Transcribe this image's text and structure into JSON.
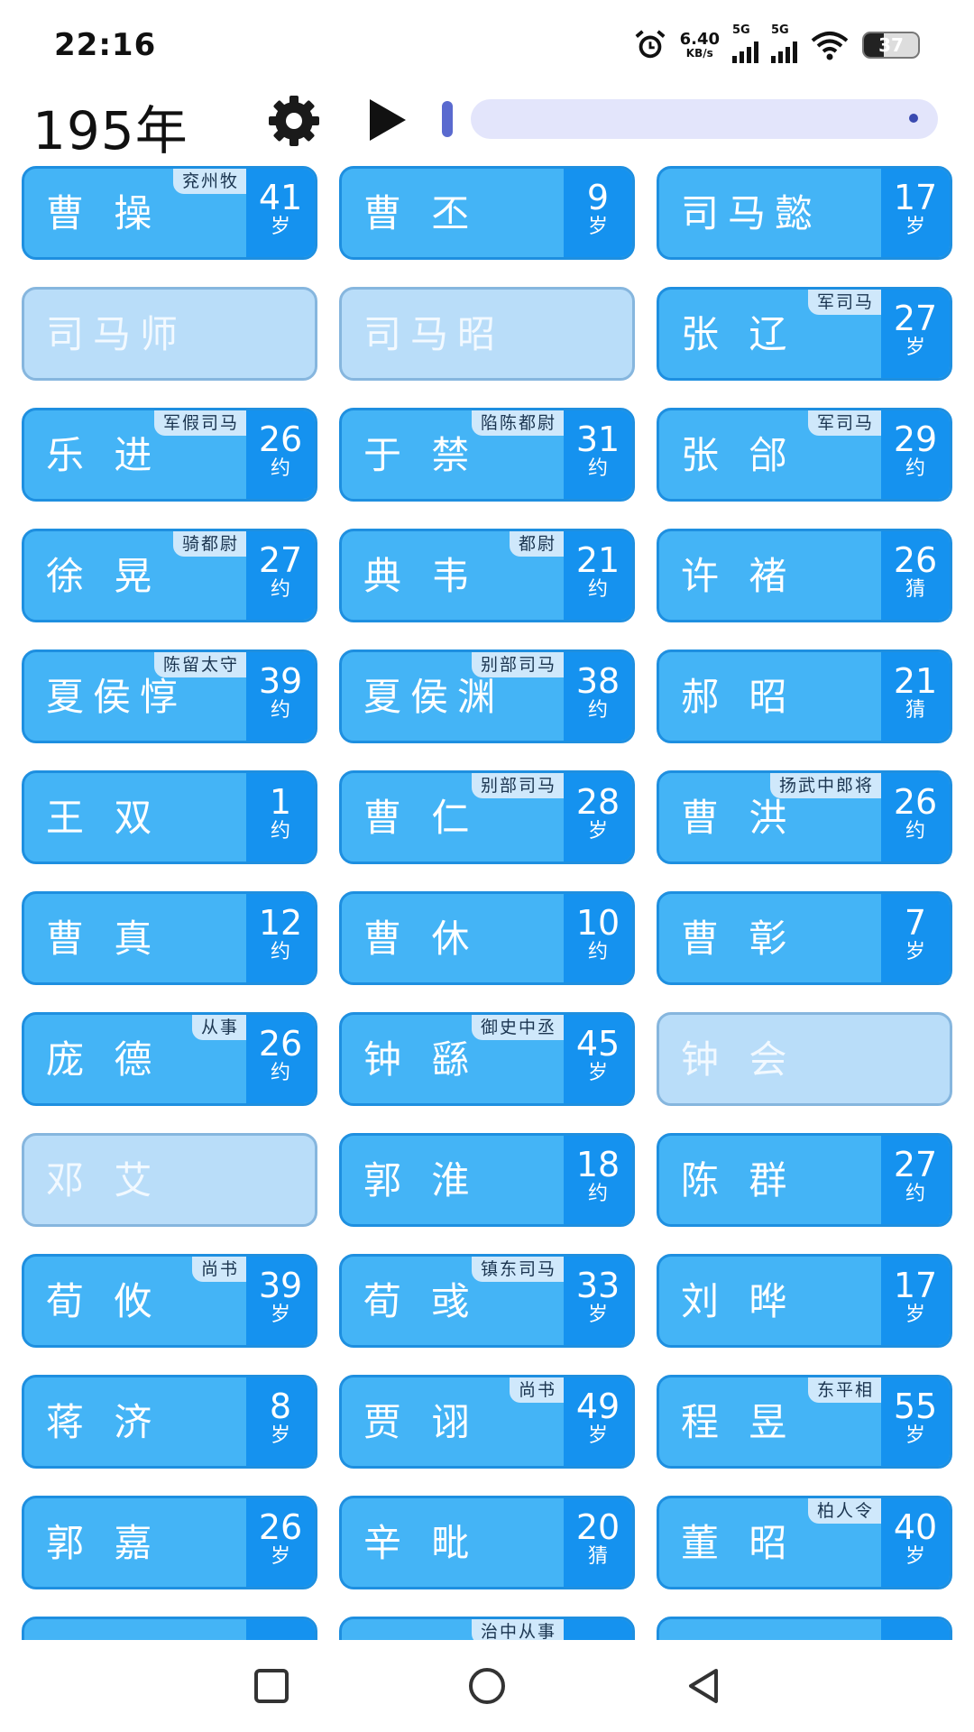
{
  "status": {
    "time": "22:16",
    "net_speed": "6.40",
    "net_unit": "KB/s",
    "sim1": "5G",
    "sim2": "5G",
    "battery": "37",
    "battery_level": 0.37
  },
  "header": {
    "year": "195年"
  },
  "cards": [
    {
      "name": "曹 操",
      "title": "兖州牧",
      "age": "41",
      "st": "岁",
      "active": true
    },
    {
      "name": "曹 丕",
      "title": "",
      "age": "9",
      "st": "岁",
      "active": true
    },
    {
      "name": "司马懿",
      "title": "",
      "age": "17",
      "st": "岁",
      "active": true
    },
    {
      "name": "司马师",
      "title": "",
      "age": "",
      "st": "",
      "active": false
    },
    {
      "name": "司马昭",
      "title": "",
      "age": "",
      "st": "",
      "active": false
    },
    {
      "name": "张 辽",
      "title": "军司马",
      "age": "27",
      "st": "岁",
      "active": true
    },
    {
      "name": "乐 进",
      "title": "军假司马",
      "age": "26",
      "st": "约",
      "active": true
    },
    {
      "name": "于 禁",
      "title": "陷陈都尉",
      "age": "31",
      "st": "约",
      "active": true
    },
    {
      "name": "张 郃",
      "title": "军司马",
      "age": "29",
      "st": "约",
      "active": true
    },
    {
      "name": "徐 晃",
      "title": "骑都尉",
      "age": "27",
      "st": "约",
      "active": true
    },
    {
      "name": "典 韦",
      "title": "都尉",
      "age": "21",
      "st": "约",
      "active": true
    },
    {
      "name": "许 褚",
      "title": "",
      "age": "26",
      "st": "猜",
      "active": true
    },
    {
      "name": "夏侯惇",
      "title": "陈留太守",
      "age": "39",
      "st": "约",
      "active": true
    },
    {
      "name": "夏侯渊",
      "title": "别部司马",
      "age": "38",
      "st": "约",
      "active": true
    },
    {
      "name": "郝 昭",
      "title": "",
      "age": "21",
      "st": "猜",
      "active": true
    },
    {
      "name": "王 双",
      "title": "",
      "age": "1",
      "st": "约",
      "active": true
    },
    {
      "name": "曹 仁",
      "title": "别部司马",
      "age": "28",
      "st": "岁",
      "active": true
    },
    {
      "name": "曹 洪",
      "title": "扬武中郎将",
      "age": "26",
      "st": "约",
      "active": true
    },
    {
      "name": "曹 真",
      "title": "",
      "age": "12",
      "st": "约",
      "active": true
    },
    {
      "name": "曹 休",
      "title": "",
      "age": "10",
      "st": "约",
      "active": true
    },
    {
      "name": "曹 彰",
      "title": "",
      "age": "7",
      "st": "岁",
      "active": true
    },
    {
      "name": "庞 德",
      "title": "从事",
      "age": "26",
      "st": "约",
      "active": true
    },
    {
      "name": "钟 繇",
      "title": "御史中丞",
      "age": "45",
      "st": "岁",
      "active": true
    },
    {
      "name": "钟 会",
      "title": "",
      "age": "",
      "st": "",
      "active": false
    },
    {
      "name": "邓 艾",
      "title": "",
      "age": "",
      "st": "",
      "active": false
    },
    {
      "name": "郭 淮",
      "title": "",
      "age": "18",
      "st": "约",
      "active": true
    },
    {
      "name": "陈 群",
      "title": "",
      "age": "27",
      "st": "约",
      "active": true
    },
    {
      "name": "荀 攸",
      "title": "尚书",
      "age": "39",
      "st": "岁",
      "active": true
    },
    {
      "name": "荀 彧",
      "title": "镇东司马",
      "age": "33",
      "st": "岁",
      "active": true
    },
    {
      "name": "刘 晔",
      "title": "",
      "age": "17",
      "st": "岁",
      "active": true
    },
    {
      "name": "蒋 济",
      "title": "",
      "age": "8",
      "st": "岁",
      "active": true
    },
    {
      "name": "贾 诩",
      "title": "尚书",
      "age": "49",
      "st": "岁",
      "active": true
    },
    {
      "name": "程 昱",
      "title": "东平相",
      "age": "55",
      "st": "岁",
      "active": true
    },
    {
      "name": "郭 嘉",
      "title": "",
      "age": "26",
      "st": "岁",
      "active": true
    },
    {
      "name": "辛 毗",
      "title": "",
      "age": "20",
      "st": "猜",
      "active": true
    },
    {
      "name": "董 昭",
      "title": "柏人令",
      "age": "40",
      "st": "岁",
      "active": true
    },
    {
      "name": "",
      "title": "",
      "age": "",
      "st": "",
      "active": true
    },
    {
      "name": "",
      "title": "治中从事",
      "age": "",
      "st": "",
      "active": true
    },
    {
      "name": "",
      "title": "",
      "age": "",
      "st": "",
      "active": true
    }
  ],
  "colors": {
    "card": "#44b4f6",
    "card_side": "#1592ef",
    "card_inactive": "#b9ddf9",
    "title_tag": "#cfe8fb",
    "slider_track": "#e3e5fb"
  },
  "icons": {
    "settings": "gear-icon",
    "play": "play-icon",
    "nav": [
      "recent-apps-icon",
      "home-icon",
      "back-icon"
    ]
  }
}
